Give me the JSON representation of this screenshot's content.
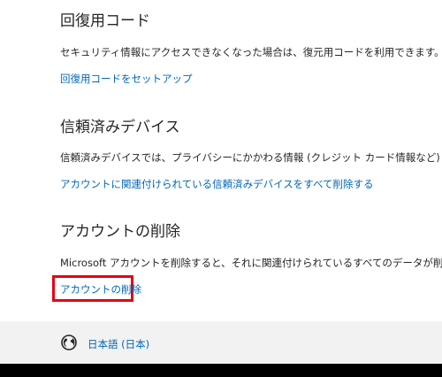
{
  "sections": {
    "recovery": {
      "title": "回復用コード",
      "description": "セキュリティ情報にアクセスできなくなった場合は、復元用コードを利用できます。復元用コードを印刷",
      "link": "回復用コードをセットアップ"
    },
    "trusted_devices": {
      "title": "信頼済みデバイス",
      "description": "信頼済みデバイスでは、プライバシーにかかわる情報 (クレジット カード情報など) にアクセスするために",
      "link": "アカウントに関連付けられている信頼済みデバイスをすべて削除する"
    },
    "delete_account": {
      "title": "アカウントの削除",
      "description": "Microsoft アカウントを削除すると、それに関連付けられているすべてのデータが削除されます。",
      "link": "アカウントの削除"
    }
  },
  "footer": {
    "language": "日本語 (日本)",
    "language_icon": "globe-icon"
  },
  "colors": {
    "link": "#0067b8",
    "text": "#262626",
    "highlight": "#e60012",
    "footer_bg": "#f2f2f2"
  }
}
